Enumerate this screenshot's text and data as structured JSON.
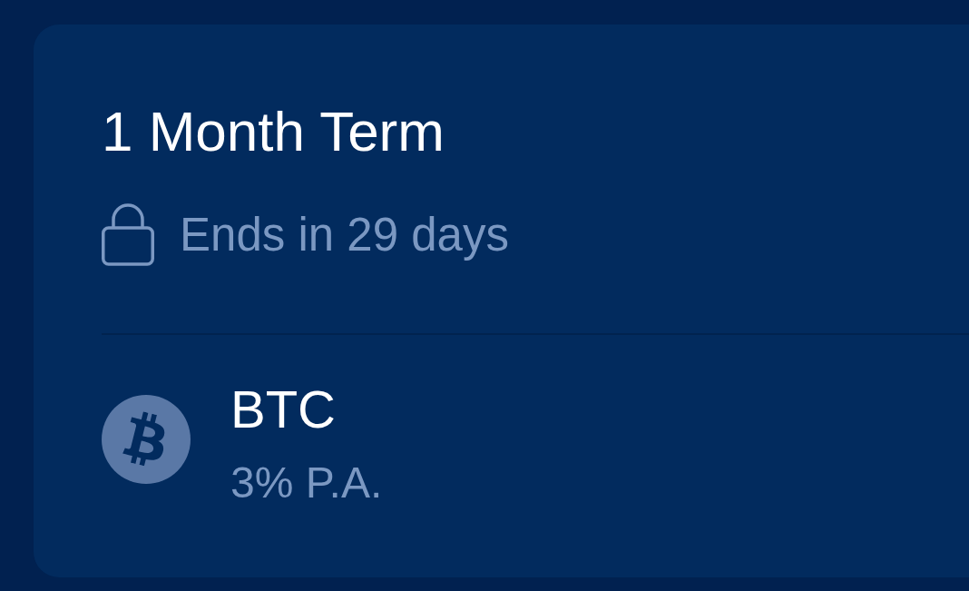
{
  "card": {
    "title": "1 Month Term",
    "countdown": "Ends in 29 days",
    "asset": {
      "symbol": "BTC",
      "rate": "3% P.A."
    }
  }
}
